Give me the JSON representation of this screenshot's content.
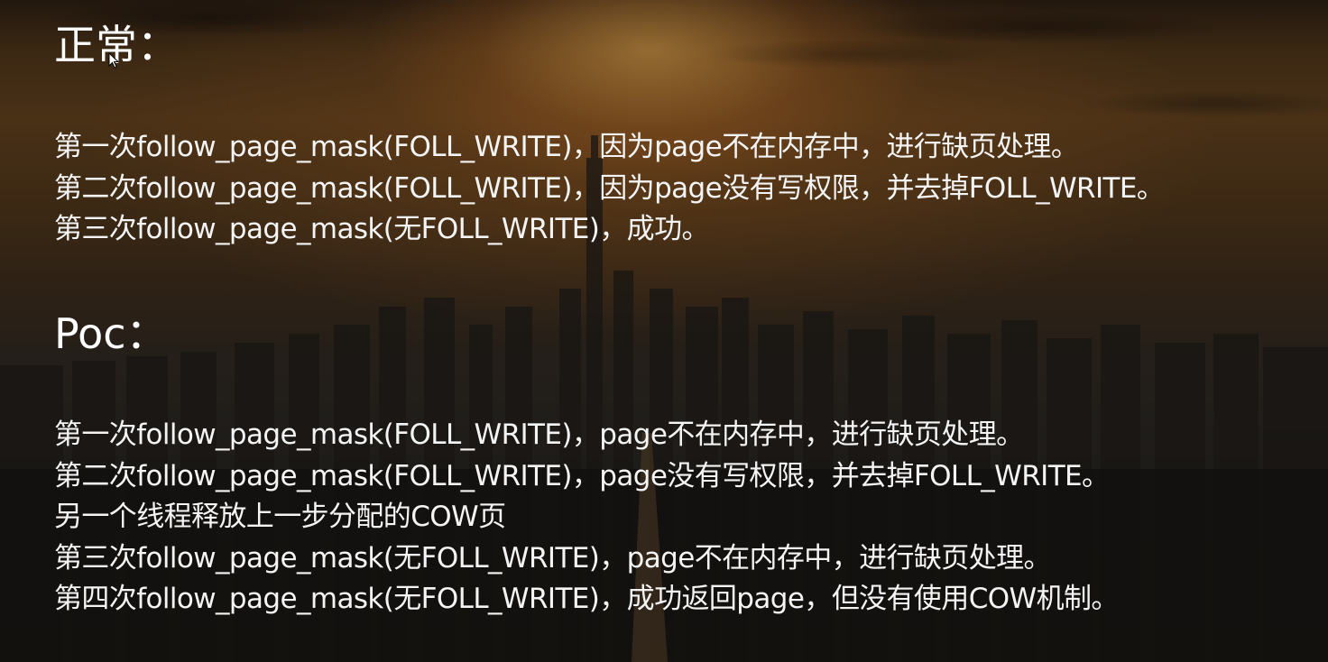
{
  "slide": {
    "normal": {
      "heading": "正常：",
      "lines": [
        "第一次follow_page_mask(FOLL_WRITE)，因为page不在内存中，进行缺页处理。",
        "第二次follow_page_mask(FOLL_WRITE)，因为page没有写权限，并去掉FOLL_WRITE。",
        "第三次follow_page_mask(无FOLL_WRITE)，成功。"
      ]
    },
    "poc": {
      "heading": "Poc：",
      "lines": [
        "第一次follow_page_mask(FOLL_WRITE)，page不在内存中，进行缺页处理。",
        "第二次follow_page_mask(FOLL_WRITE)，page没有写权限，并去掉FOLL_WRITE。",
        "另一个线程释放上一步分配的COW页",
        "第三次follow_page_mask(无FOLL_WRITE)，page不在内存中，进行缺页处理。",
        "第四次follow_page_mask(无FOLL_WRITE)，成功返回page，但没有使用COW机制。"
      ]
    }
  },
  "icons": {
    "cursor": "mouse-pointer-icon"
  },
  "colors": {
    "text": "#f4f4f4",
    "sky_glow": "#ffbe5a",
    "background_dark": "#1f1e1b"
  }
}
